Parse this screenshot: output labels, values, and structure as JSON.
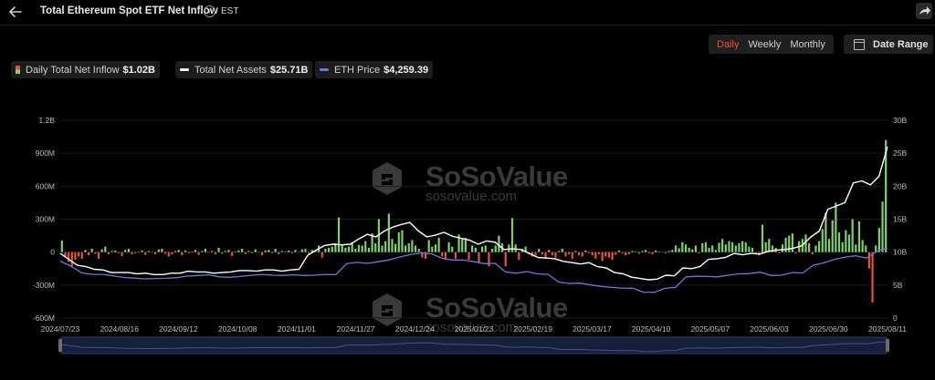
{
  "header": {
    "title": "Total Ethereum Spot ETF Net Inflow",
    "timezone": "EST"
  },
  "controls": {
    "periods": [
      "Daily",
      "Weekly",
      "Monthly"
    ],
    "active_period": "Daily",
    "date_range_label": "Date Range"
  },
  "legend": {
    "items": [
      {
        "label": "Daily Total Net Inflow",
        "value": "$1.02B"
      },
      {
        "label": "Total Net Assets",
        "value": "$25.71B"
      },
      {
        "label": "ETH Price",
        "value": "$4,259.39"
      }
    ]
  },
  "watermark": {
    "brand": "SoSoValue",
    "site": "sosovalue.com"
  },
  "colors": {
    "inflow_pos": "#7fd16a",
    "inflow_neg": "#e8533a",
    "assets_line": "#ffffff",
    "price_line": "#6b78e0"
  },
  "chart_data": {
    "type": "bar",
    "x": [
      "2024/07/23",
      "2024/08/16",
      "2024/09/12",
      "2024/10/08",
      "2024/11/01",
      "2024/11/27",
      "2024/12/24",
      "2025/01/23",
      "2025/02/19",
      "2025/03/17",
      "2025/04/10",
      "2025/05/07",
      "2025/06/03",
      "2025/06/30",
      "2025/08/11"
    ],
    "y_left_ticks": [
      "1.2B",
      "900M",
      "600M",
      "300M",
      "0",
      "-300M",
      "-600M"
    ],
    "y_left_range": [
      -600,
      1200
    ],
    "y_right_ticks": [
      "30B",
      "25B",
      "20B",
      "15B",
      "10B",
      "5B",
      "0"
    ],
    "y_right_range": [
      0,
      30
    ],
    "series": [
      {
        "name": "Daily Total Net Inflow",
        "unit": "M USD",
        "values": [
          107,
          -40,
          -90,
          -130,
          -70,
          -40,
          -60,
          20,
          -30,
          30,
          -15,
          -60,
          25,
          50,
          -20,
          10,
          15,
          -10,
          -35,
          20,
          30,
          -20,
          -10,
          5,
          15,
          -25,
          10,
          -5,
          -20,
          25,
          30,
          -15,
          -40,
          -20,
          10,
          20,
          -30,
          15,
          -10,
          5,
          20,
          -25,
          10,
          30,
          -5,
          10,
          -20,
          40,
          -15,
          10,
          20,
          -35,
          5,
          15,
          30,
          -20,
          10,
          -10,
          25,
          -5,
          -30,
          15,
          20,
          -10,
          30,
          -20,
          10,
          5,
          15,
          -10,
          20,
          -5,
          25,
          30,
          -15,
          20,
          10,
          60,
          -50,
          30,
          40,
          50,
          80,
          315,
          70,
          40,
          50,
          90,
          30,
          65,
          60,
          100,
          40,
          170,
          80,
          300,
          60,
          100,
          350,
          120,
          75,
          180,
          200,
          60,
          80,
          110,
          60,
          30,
          -50,
          -60,
          110,
          50,
          70,
          130,
          -40,
          -70,
          90,
          50,
          -60,
          160,
          120,
          130,
          -70,
          60,
          40,
          -100,
          50,
          60,
          -130,
          30,
          60,
          150,
          80,
          -130,
          70,
          310,
          70,
          -70,
          30,
          50,
          -20,
          -40,
          -30,
          30,
          -20,
          -60,
          20,
          -30,
          -50,
          10,
          30,
          -40,
          -20,
          -60,
          10,
          -30,
          -40,
          15,
          -10,
          -30,
          -60,
          -20,
          -80,
          -40,
          -50,
          -70,
          -25,
          15,
          -10,
          -30,
          -20,
          10,
          5,
          -15,
          10,
          20,
          -10,
          -20,
          15,
          5,
          -5,
          -10,
          10,
          20,
          60,
          35,
          90,
          70,
          40,
          25,
          60,
          -10,
          80,
          90,
          40,
          60,
          20,
          85,
          120,
          70,
          100,
          90,
          60,
          80,
          100,
          90,
          50,
          40,
          -15,
          -30,
          250,
          90,
          120,
          60,
          40,
          -10,
          70,
          130,
          150,
          170,
          -10,
          100,
          120,
          160,
          80,
          -20,
          60,
          100,
          210,
          360,
          120,
          290,
          450,
          180,
          90,
          200,
          160,
          300,
          70,
          280,
          110,
          60,
          -150,
          -460,
          60,
          220,
          460,
          1020
        ]
      },
      {
        "name": "Total Net Assets",
        "unit": "B USD",
        "values": [
          9.8,
          8.9,
          8.0,
          7.8,
          7.4,
          7.3,
          6.9,
          6.9,
          6.9,
          6.7,
          6.8,
          6.6,
          6.6,
          6.8,
          6.8,
          7.1,
          7.0,
          7.0,
          6.8,
          6.9,
          7.0,
          7.2,
          7.2,
          7.1,
          7.3,
          7.3,
          7.1,
          7.3,
          7.4,
          9.5,
          10.3,
          11.0,
          11.2,
          11.1,
          11.2,
          12.0,
          12.7,
          12.3,
          13.2,
          13.8,
          14.2,
          14.5,
          13.2,
          12.3,
          12.6,
          13.0,
          12.4,
          12.1,
          11.8,
          11.2,
          11.7,
          11.5,
          10.4,
          10.5,
          10.4,
          9.8,
          9.2,
          9.1,
          9.0,
          8.6,
          8.4,
          8.2,
          8.4,
          7.8,
          7.6,
          6.9,
          6.7,
          6.2,
          6.0,
          5.8,
          5.9,
          6.5,
          6.4,
          7.6,
          7.5,
          7.8,
          8.9,
          9.0,
          9.2,
          9.8,
          9.6,
          9.8,
          9.7,
          10.1,
          10.3,
          10.4,
          10.6,
          11.0,
          12.3,
          13.2,
          16.5,
          17.0,
          17.5,
          20.5,
          20.8,
          20.2,
          21.5,
          26.0
        ]
      },
      {
        "name": "ETH Price",
        "unit": "USD",
        "values": [
          3450,
          3150,
          2750,
          2650,
          2650,
          2560,
          2460,
          2420,
          2380,
          2400,
          2410,
          2450,
          2550,
          2580,
          2620,
          2500,
          2470,
          2520,
          2600,
          2640,
          2600,
          2590,
          2620,
          2580,
          2600,
          2650,
          2640,
          3300,
          3380,
          3320,
          3420,
          3520,
          3700,
          3850,
          3950,
          3900,
          3620,
          3520,
          3520,
          3420,
          3300,
          3320,
          2790,
          2720,
          2820,
          2680,
          2650,
          2180,
          2100,
          2120,
          2010,
          1920,
          1860,
          1820,
          1810,
          1570,
          1560,
          1800,
          1850,
          2500,
          2530,
          2520,
          2500,
          2600,
          2680,
          2700,
          2780,
          2580,
          2600,
          2760,
          2730,
          3200,
          3350,
          3560,
          3700,
          3780,
          3640,
          4050,
          4259
        ]
      }
    ]
  }
}
